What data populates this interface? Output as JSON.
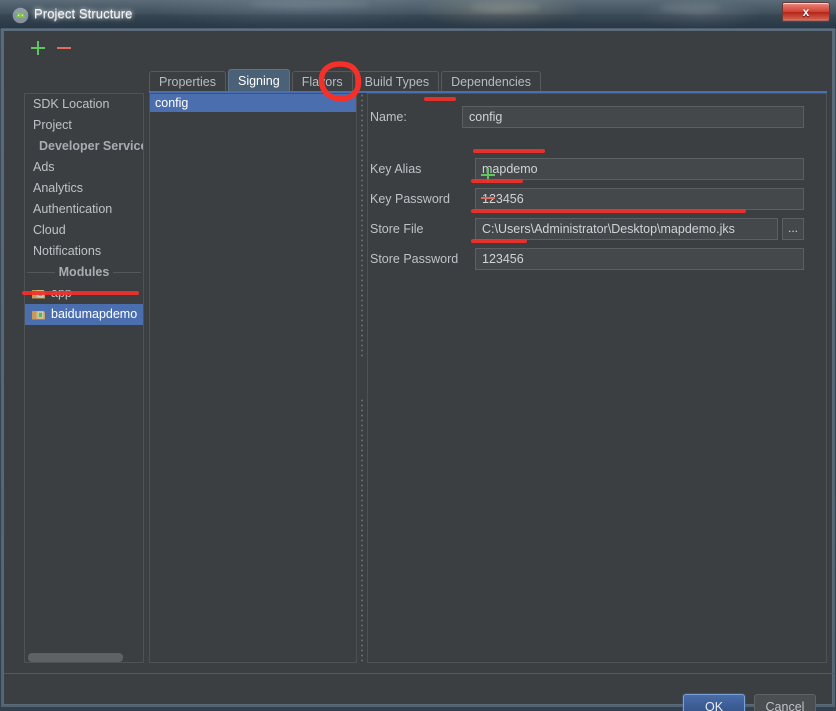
{
  "window": {
    "title": "Project Structure",
    "title_icon": "android-studio-icon",
    "close_label": "x"
  },
  "sidebar": {
    "toolbar": {
      "add_label": "+",
      "remove_label": "−",
      "add_icon": "plus-icon",
      "remove_icon": "minus-icon"
    },
    "items": [
      {
        "label": "SDK Location",
        "type": "item",
        "selected": false
      },
      {
        "label": "Project",
        "type": "item",
        "selected": false
      },
      {
        "label": "Developer Service",
        "type": "header",
        "selected": false
      },
      {
        "label": "Ads",
        "type": "item",
        "selected": false
      },
      {
        "label": "Analytics",
        "type": "item",
        "selected": false
      },
      {
        "label": "Authentication",
        "type": "item",
        "selected": false
      },
      {
        "label": "Cloud",
        "type": "item",
        "selected": false
      },
      {
        "label": "Notifications",
        "type": "item",
        "selected": false
      },
      {
        "label": "Modules",
        "type": "separator",
        "selected": false
      },
      {
        "label": "app",
        "type": "module",
        "selected": false,
        "icon": "module-icon"
      },
      {
        "label": "baidumapdemo",
        "type": "module",
        "selected": true,
        "icon": "module-icon"
      }
    ]
  },
  "tabs": [
    {
      "label": "Properties",
      "active": false
    },
    {
      "label": "Signing",
      "active": true
    },
    {
      "label": "Flavors",
      "active": false
    },
    {
      "label": "Build Types",
      "active": false
    },
    {
      "label": "Dependencies",
      "active": false
    }
  ],
  "signing": {
    "config_list": [
      {
        "label": "config",
        "selected": true
      }
    ],
    "list_buttons": {
      "add_icon": "plus-icon",
      "remove_icon": "minus-icon"
    },
    "fields": [
      {
        "label": "Name:",
        "value": "config",
        "placeholder": "",
        "name": "name"
      },
      {
        "label": "Key Alias",
        "value": "mapdemo",
        "placeholder": "",
        "name": "key-alias"
      },
      {
        "label": "Key Password",
        "value": "123456",
        "placeholder": "",
        "name": "key-password"
      },
      {
        "label": "Store File",
        "value": "C:\\Users\\Administrator\\Desktop\\mapdemo.jks",
        "placeholder": "",
        "name": "store-file"
      },
      {
        "label": "Store Password",
        "value": "123456",
        "placeholder": "",
        "name": "store-password"
      }
    ],
    "browse_label": "..."
  },
  "footer": {
    "ok_label": "OK",
    "cancel_label": "Cancel"
  },
  "colors": {
    "panel_bg": "#3c3f41",
    "selection_blue": "#4b6eaf",
    "tab_active_bg": "#4b6178",
    "accent_green": "#62c462",
    "accent_red": "#e06c5f",
    "annotation_red": "#f4302a",
    "close_button_red": "#cf4434",
    "text": "#bdc3c7"
  }
}
